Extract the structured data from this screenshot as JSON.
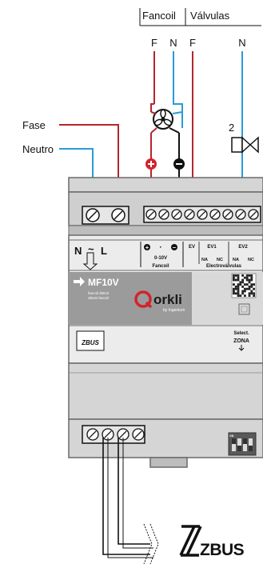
{
  "header": {
    "fancoil": "Fancoil",
    "valvulas": "Válvulas",
    "terminal_fancoil_f": "F",
    "terminal_fancoil_n": "N",
    "terminal_valvulas_f": "F",
    "terminal_valvulas_n": "N"
  },
  "left_labels": {
    "fase": "Fase",
    "neutro": "Neutro"
  },
  "valve_number": "2",
  "module": {
    "input_symbol_n": "N",
    "input_symbol_ac": "~",
    "input_symbol_l": "L",
    "fancoil_plus": "+",
    "fancoil_dot": "·",
    "fancoil_minus": "−",
    "fancoil_range": "0-10V",
    "fancoil_caption": "Fancoil",
    "ev_label": "EV",
    "ev1": "EV1",
    "ev2": "EV2",
    "na": "NA",
    "nc": "NC",
    "electrovalves_caption": "Electroválvulas",
    "model": "MF10V",
    "desc_line1": "fancoil ZBUS",
    "desc_line2": "ZBUS fancoil",
    "brand": "orkli",
    "brand_sub": "by Ingenium",
    "zbus_badge": "ZBUS",
    "select_line1": "Select.",
    "select_line2": "ZONA",
    "switch_on": "ON"
  },
  "zbus_logo": "ZBUS",
  "colors": {
    "phase": "#b3262d",
    "neutral": "#2a9bd8",
    "bus": "#111111",
    "module_body": "#d5d5d5",
    "label_panel": "#ececec",
    "grey_band": "#9b9b9b",
    "brand_red": "#d1242c"
  },
  "icons": [
    "fan-icon",
    "valve-icon",
    "qr-code-icon",
    "dip-switch-icon",
    "orkli-logo-icon",
    "zbus-logo-icon"
  ]
}
